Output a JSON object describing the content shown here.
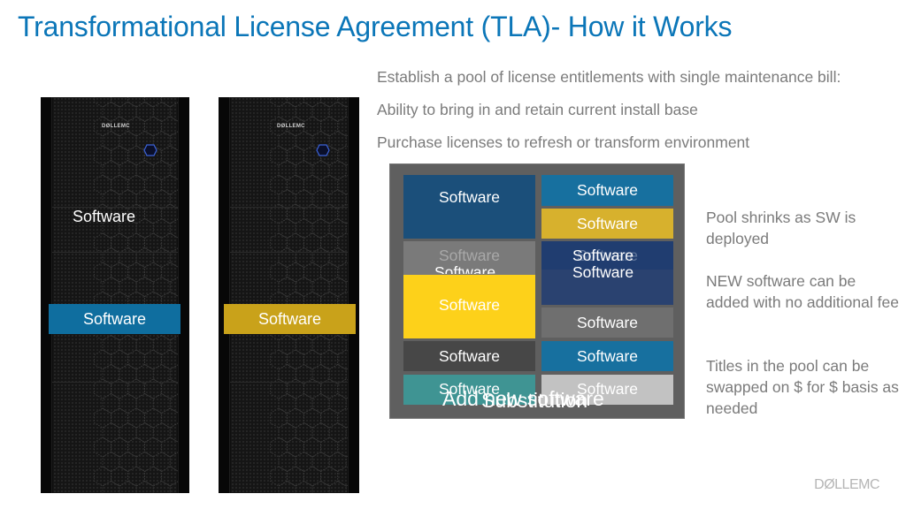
{
  "title": "Transformational License Agreement (TLA)- How it Works",
  "bullets": [
    "Establish a pool of license entitlements with single maintenance bill:",
    "Ability to bring in and retain current install base",
    "Purchase licenses to refresh or transform environment"
  ],
  "racks": [
    {
      "logo": "DØLLEMC",
      "floating_label": "Software",
      "band_label": "Software",
      "band_color": "#0f6e9f"
    },
    {
      "logo": "DØLLEMC",
      "band_label": "Software",
      "band_color": "#c9a21a"
    }
  ],
  "pool": {
    "background": "#5f5f5f",
    "left_column": [
      {
        "label": "Software",
        "color": "#1b4f7a"
      },
      {
        "label": "Software",
        "color": "#7a7a7a",
        "text_color": "#a8a8a8",
        "ghost_label": "Software"
      },
      {
        "label": "Software",
        "color": "#fdd11a"
      },
      {
        "label": "Software",
        "color": "#474747"
      },
      {
        "label": "Software",
        "color": "#3f9493"
      }
    ],
    "right_column": [
      {
        "label": "Software",
        "color": "#17709f"
      },
      {
        "label": "Software",
        "color": "#d7b12d"
      },
      {
        "label": "Software",
        "color": "#1d3c70",
        "ghost_label": "Software"
      },
      {
        "label": "Software",
        "color": "#6f6f6f"
      },
      {
        "label": "Software",
        "color": "#17709f"
      },
      {
        "label": "Software",
        "color": "#c2c2c2"
      }
    ],
    "overlay_labels": [
      "Add new software",
      "Substitution"
    ]
  },
  "notes": [
    "Pool shrinks as SW is deployed",
    "NEW software can be added with no additional fee",
    "Titles in the pool can be swapped on $ for $ basis as needed"
  ],
  "footer_brand": "DØLLEMC"
}
